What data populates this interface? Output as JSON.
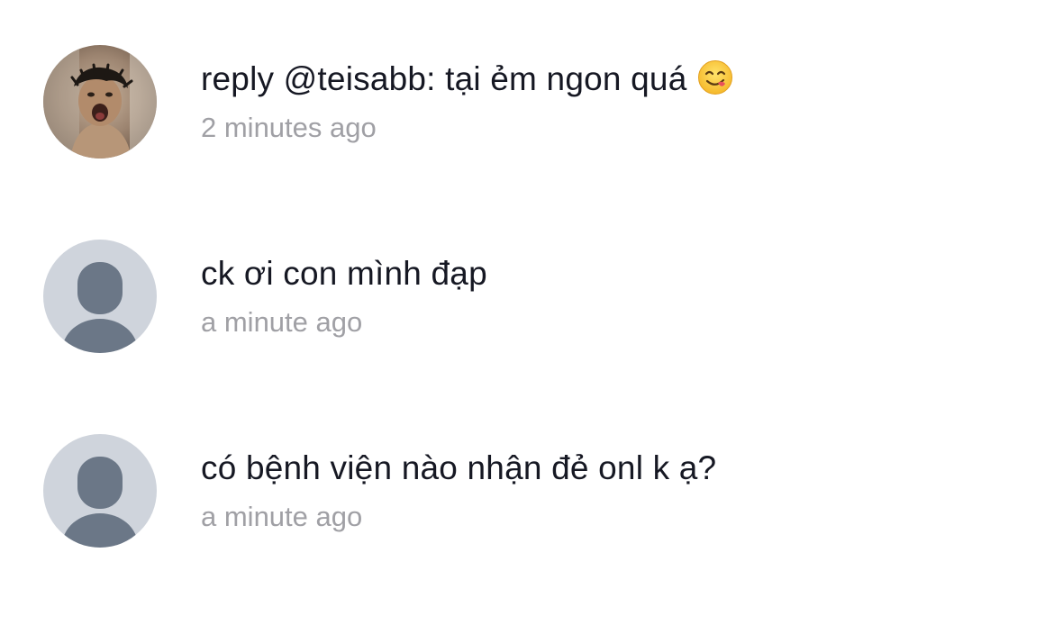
{
  "comments": [
    {
      "text": "reply @teisabb: tại ẻm ngon quá",
      "emoji": "yum-face-emoji",
      "time": "2 minutes ago",
      "avatar": "photo-avatar"
    },
    {
      "text": "ck ơi con mình đạp",
      "time": "a minute ago",
      "avatar": "default-user-icon"
    },
    {
      "text": "có bệnh viện nào nhận đẻ onl k ạ?",
      "time": "a minute ago",
      "avatar": "default-user-icon"
    }
  ],
  "colors": {
    "text": "#161823",
    "timestamp": "#a0a0a5",
    "default_avatar_bg": "#cfd4dc",
    "default_avatar_figure": "#6b7787"
  }
}
